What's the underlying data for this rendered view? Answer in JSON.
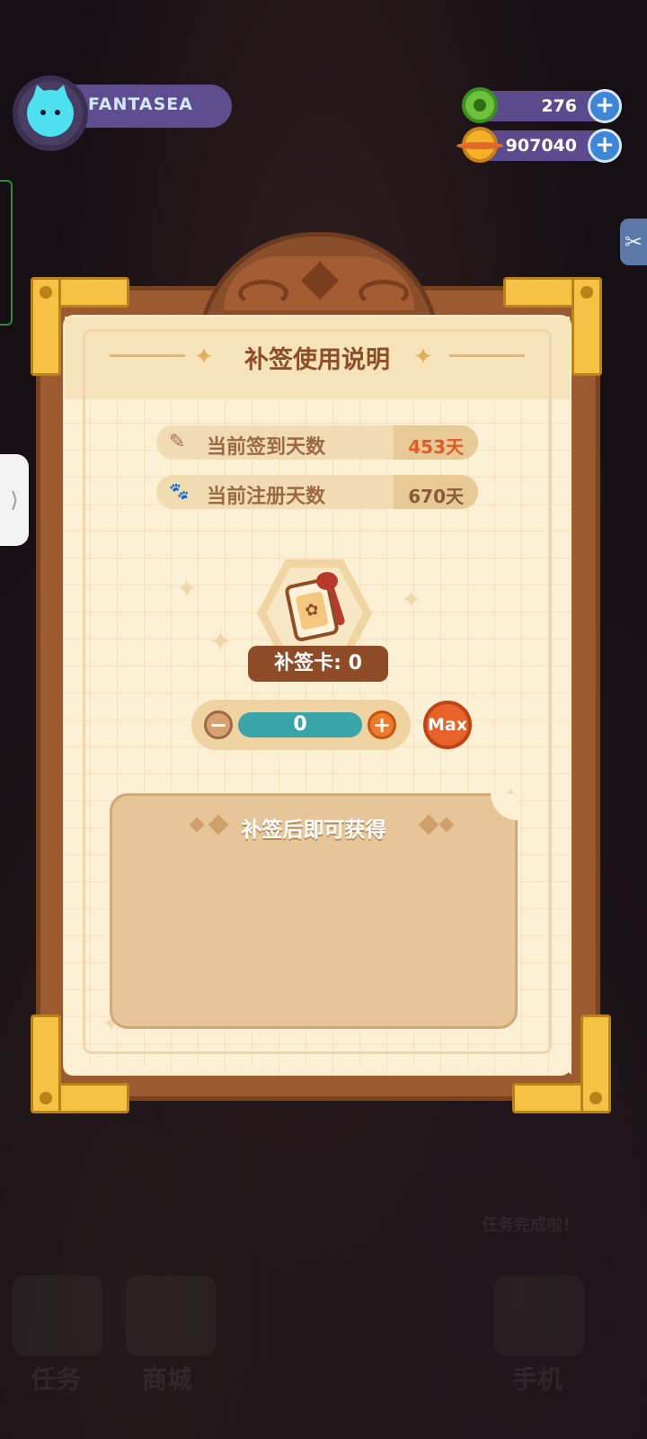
{
  "player": {
    "name": "FANTASEA"
  },
  "currencies": [
    {
      "name": "green-gem",
      "value": "276",
      "color": "#6cc23b"
    },
    {
      "name": "gold-planet",
      "value": "907040",
      "color": "#f2b128"
    }
  ],
  "dialog": {
    "title": "补签使用说明",
    "stats": [
      {
        "icon": "pencil-icon",
        "glyph": "✎",
        "label": "当前签到天数",
        "value": "453天",
        "value_color": "#e35a2a"
      },
      {
        "icon": "paw-icon",
        "glyph": "🐾",
        "label": "当前注册天数",
        "value": "670天",
        "value_color": "#8a5a3a"
      }
    ],
    "card_label": "补签卡: 0",
    "quantity": "0",
    "minus_label": "−",
    "plus_label": "+",
    "max_label": "Max",
    "reward_title": "补签后即可获得"
  },
  "side_tab_glyph": "⟩",
  "clip_glyph": "✂",
  "background_hints": [
    "任务",
    "商城",
    "手机",
    "任务完成啦！"
  ]
}
